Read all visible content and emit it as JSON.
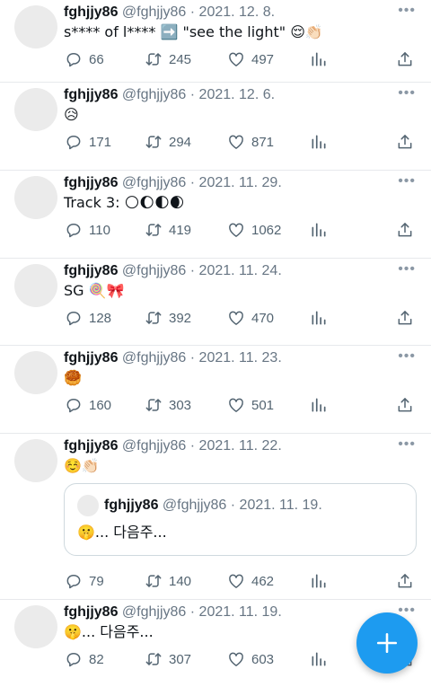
{
  "tweets": [
    {
      "name": "fghjjy86",
      "handle": "@fghjjy86",
      "date": "2021. 12. 8.",
      "text": "s**** of l**** ➡️ \"see the light\" 😌👏🏻",
      "replies": "66",
      "retweets": "245",
      "likes": "497"
    },
    {
      "name": "fghjjy86",
      "handle": "@fghjjy86",
      "date": "2021. 12. 6.",
      "text": "😥",
      "replies": "171",
      "retweets": "294",
      "likes": "871"
    },
    {
      "name": "fghjjy86",
      "handle": "@fghjjy86",
      "date": "2021. 11. 29.",
      "text": "Track 3: 🌕🌔🌓🌒",
      "replies": "110",
      "retweets": "419",
      "likes": "1062"
    },
    {
      "name": "fghjjy86",
      "handle": "@fghjjy86",
      "date": "2021. 11. 24.",
      "text": "SG 🍭🎀",
      "replies": "128",
      "retweets": "392",
      "likes": "470"
    },
    {
      "name": "fghjjy86",
      "handle": "@fghjjy86",
      "date": "2021. 11. 23.",
      "text": "🥮",
      "replies": "160",
      "retweets": "303",
      "likes": "501"
    },
    {
      "name": "fghjjy86",
      "handle": "@fghjjy86",
      "date": "2021. 11. 22.",
      "text": "☺️👏🏻",
      "replies": "79",
      "retweets": "140",
      "likes": "462",
      "quote": {
        "name": "fghjjy86",
        "handle": "@fghjjy86",
        "date": "2021. 11. 19.",
        "text": "🤫... 다음주..."
      }
    },
    {
      "name": "fghjjy86",
      "handle": "@fghjjy86",
      "date": "2021. 11. 19.",
      "text": "🤫... 다음주...",
      "replies": "82",
      "retweets": "307",
      "likes": "603"
    }
  ],
  "ui": {
    "separator": "·",
    "more_glyph": "•••",
    "accent_color": "#1d9bf0",
    "icons": {
      "reply": "reply-icon",
      "retweet": "retweet-icon",
      "like": "heart-icon",
      "views": "views-icon",
      "share": "share-icon",
      "compose": "plus-icon",
      "more": "more-icon"
    }
  }
}
